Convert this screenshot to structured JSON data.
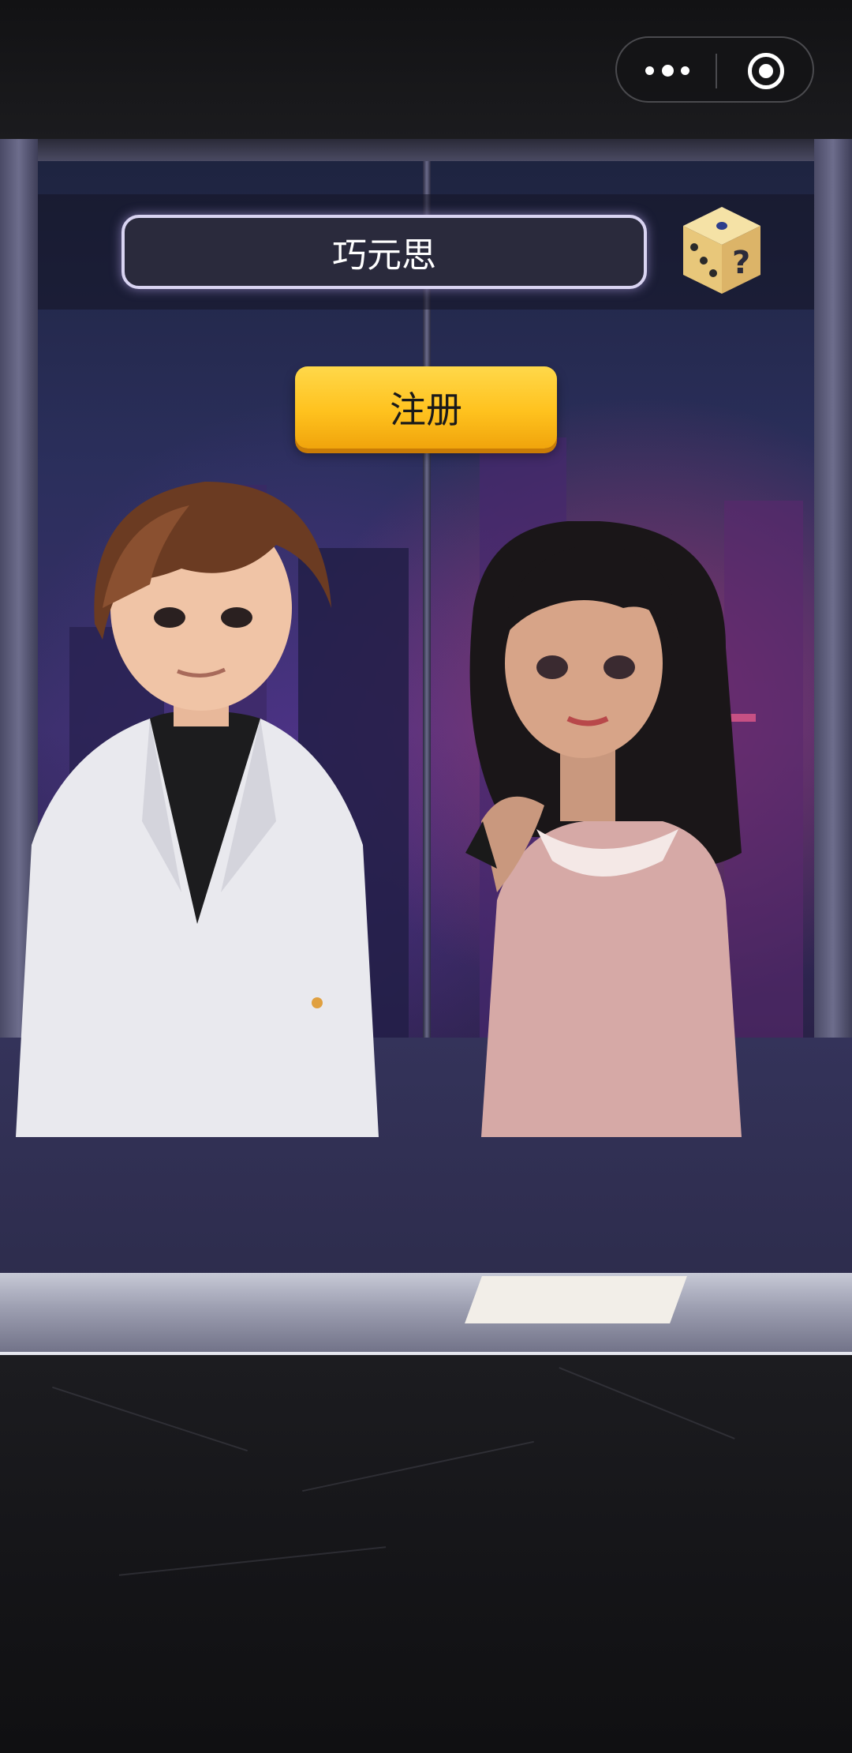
{
  "menu_capsule": {
    "more_icon": "more-dots-icon",
    "close_icon": "target-circle-icon"
  },
  "register": {
    "name_value": "巧元思",
    "dice_icon": "random-name-dice-icon",
    "submit_label": "注册",
    "submit_color": "#ffc21e"
  },
  "scene": {
    "characters": [
      "boy-avatar",
      "girl-avatar"
    ]
  }
}
